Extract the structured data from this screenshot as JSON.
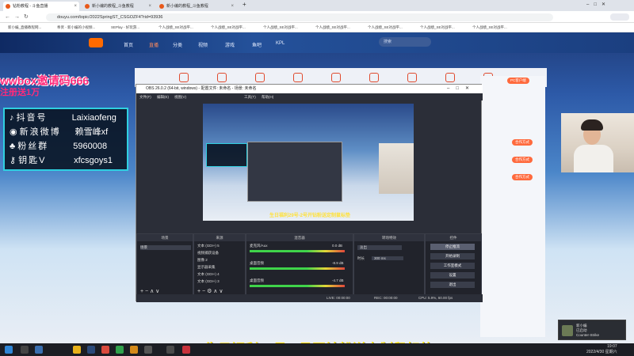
{
  "browser": {
    "tabs": [
      {
        "label": "钻粉教程 - 斗鱼直播",
        "active": true
      },
      {
        "label": "新小编的教程_斗鱼教程",
        "active": false
      },
      {
        "label": "新小编的教程_斗鱼教程",
        "active": false
      }
    ],
    "new_tab": "+",
    "url": "douyu.com/topic/2022SpringST_CSGOZF4?rid=93936",
    "bookmarks": [
      "新小编_直播教程网...",
      "奉贤 - 新小编的小视频...",
      "SEPlay - 好玩游...",
      "个人战绩_SE对战平...",
      "个人战绩_SE对战平...",
      "个人战绩_SE对战平...",
      "个人战绩_SE对战平...",
      "个人战绩_SE对战平...",
      "个人战绩_SE对战平...",
      "个人战绩_SE对战平..."
    ]
  },
  "site": {
    "nav": [
      "首页",
      "直播",
      "分类",
      "视频",
      "游戏",
      "鱼吧",
      "KPL"
    ],
    "search_placeholder": "搜索",
    "pills": [
      "PC客户端",
      "合作方式",
      "合作方式",
      "合作方式"
    ]
  },
  "overlay": {
    "promo_line1": "wwbox邀请码666",
    "promo_line2": "注册送1万",
    "info": [
      {
        "key": "抖音号",
        "value": "Laixiaofeng",
        "icon": "tiktok-icon"
      },
      {
        "key": "新浪微博",
        "value": "赖雪峰xf",
        "icon": "weibo-icon"
      },
      {
        "key": "粉丝群",
        "value": "5960008",
        "icon": "group-icon"
      },
      {
        "key": "钥匙V",
        "value": "xfcsgoys1",
        "icon": "key-icon"
      }
    ],
    "subtitle": "生日福利29号-2号开钻粉送定制鼠标垫"
  },
  "obs": {
    "title": "OBS 26.0.2 (64-bit, windows) - 配置文件: 未命名 - 场景: 未命名",
    "menu": [
      "文件(F)",
      "编辑(E)",
      "视图(V)",
      "工具(T)",
      "帮助(H)"
    ],
    "nested_subtitle": "生日福利29号-2号开钻粉送定制鼠标垫",
    "docks": {
      "scenes": {
        "title": "场景",
        "items": [
          "场景"
        ]
      },
      "sources": {
        "title": "来源",
        "items": [
          "文本 (GDI+) 5",
          "视频捕获设备",
          "图像 2",
          "显示器采集",
          "文本 (GDI+) 4",
          "文本 (GDI+) 3"
        ]
      },
      "mixer": {
        "title": "混音器",
        "tracks": [
          {
            "name": "麦克风/Aux",
            "db": "0.0 dB"
          },
          {
            "name": "桌面音频",
            "db": "-8.9 dB"
          },
          {
            "name": "桌面音频",
            "db": "-4.7 dB"
          }
        ]
      },
      "transitions": {
        "title": "转场特效",
        "mode": "淡出",
        "duration_label": "时长",
        "duration": "300 ms"
      },
      "controls": {
        "title": "控件",
        "buttons": [
          "停止推流",
          "开始录制",
          "工作室模式",
          "设置",
          "退出"
        ]
      }
    },
    "status": [
      "LIVE: 00:00:00",
      "REC: 00:00:00",
      "CPU: 5.9%, 60.00 fps"
    ]
  },
  "taskbar": {
    "time": "19:07",
    "date": "2022/4/30 星期六",
    "notification": "新小编\n已启动\nCounter-Strike"
  }
}
